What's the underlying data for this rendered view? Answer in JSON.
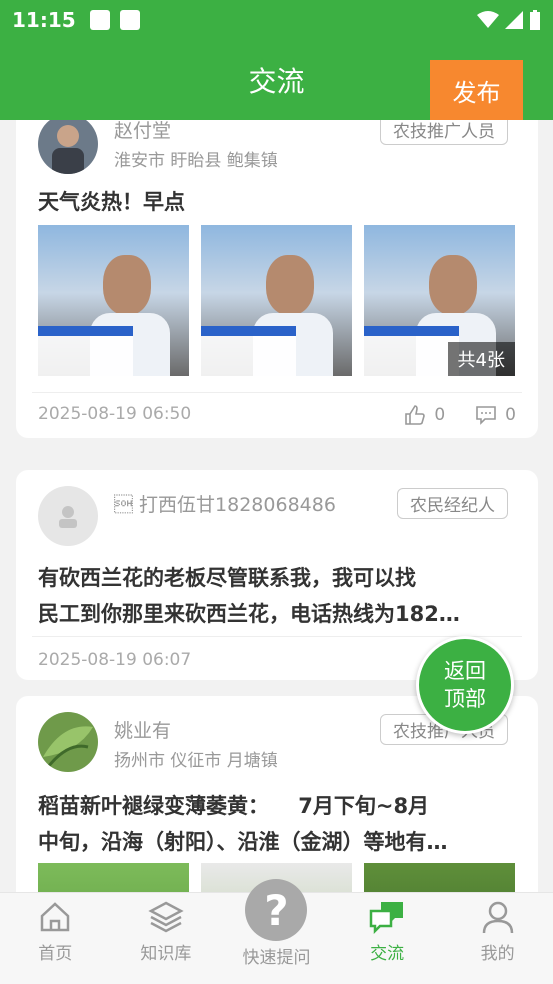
{
  "status_bar": {
    "time": "11:15"
  },
  "header": {
    "title": "交流",
    "publish_label": "发布"
  },
  "posts": [
    {
      "author": "赵付堂",
      "location": "淮安市 盱眙县 鲍集镇",
      "role": "农技推广人员",
      "text": "天气炎热！早点",
      "image_count_label": "共4张",
      "time": "2025-08-19 06:50",
      "likes": "0",
      "comments": "0"
    },
    {
      "author": "\u0001 打西伍甘1828068486",
      "location": "",
      "role": "农民经纪人",
      "text_line1": "有砍西兰花的老板尽管联系我，我可以找",
      "text_line2": "民工到你那里来砍西兰花，电话热线为182…",
      "time": "2025-08-19 06:07"
    },
    {
      "author": "姚业有",
      "location": "扬州市 仪征市 月塘镇",
      "role": "农技推广人员",
      "text_line1": "稻苗新叶褪绿变薄萎黄：    7月下旬~8月",
      "text_line2": "中旬，沿海（射阳）、沿淮（金湖）等地有…"
    }
  ],
  "back_to_top": {
    "line1": "返回",
    "line2": "顶部"
  },
  "tabs": [
    {
      "label": "首页",
      "icon": "home-icon"
    },
    {
      "label": "知识库",
      "icon": "layers-icon"
    },
    {
      "label": "快速提问",
      "icon": "question-icon"
    },
    {
      "label": "交流",
      "icon": "chat-icon",
      "active": true
    },
    {
      "label": "我的",
      "icon": "person-icon"
    }
  ],
  "colors": {
    "brand": "#3cb043",
    "publish": "#f7882f"
  }
}
